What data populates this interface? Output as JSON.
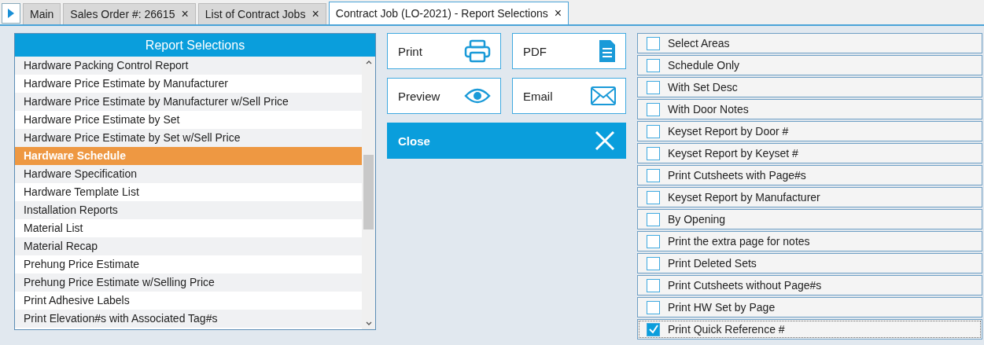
{
  "tabs": [
    {
      "label": "Main",
      "selected": false,
      "closable": false
    },
    {
      "label": "Sales Order #: 26615",
      "selected": false,
      "closable": true
    },
    {
      "label": "List of Contract Jobs",
      "selected": false,
      "closable": true
    },
    {
      "label": "Contract Job (LO-2021) - Report Selections",
      "selected": true,
      "closable": true
    }
  ],
  "close_glyph": "×",
  "report_list": {
    "title": "Report Selections",
    "items": [
      {
        "label": "Hardware Packing Control Report",
        "selected": false
      },
      {
        "label": "Hardware Price Estimate by Manufacturer",
        "selected": false
      },
      {
        "label": "Hardware Price Estimate by Manufacturer w/Sell Price",
        "selected": false
      },
      {
        "label": "Hardware Price Estimate by Set",
        "selected": false
      },
      {
        "label": "Hardware Price Estimate by Set w/Sell Price",
        "selected": false
      },
      {
        "label": "Hardware Schedule",
        "selected": true
      },
      {
        "label": "Hardware Specification",
        "selected": false
      },
      {
        "label": "Hardware Template List",
        "selected": false
      },
      {
        "label": "Installation Reports",
        "selected": false
      },
      {
        "label": "Material List",
        "selected": false
      },
      {
        "label": "Material Recap",
        "selected": false
      },
      {
        "label": "Prehung Price Estimate",
        "selected": false
      },
      {
        "label": "Prehung Price Estimate w/Selling Price",
        "selected": false
      },
      {
        "label": "Print Adhesive Labels",
        "selected": false
      },
      {
        "label": "Print Elevation#s with Associated Tag#s",
        "selected": false
      }
    ]
  },
  "actions": [
    {
      "label": "Print",
      "kind": "print"
    },
    {
      "label": "PDF",
      "kind": "pdf"
    },
    {
      "label": "Preview",
      "kind": "preview"
    },
    {
      "label": "Email",
      "kind": "email"
    },
    {
      "label": "Close",
      "kind": "close"
    }
  ],
  "options": [
    {
      "label": "Select Areas",
      "checked": false,
      "focused": false
    },
    {
      "label": "Schedule Only",
      "checked": false,
      "focused": false
    },
    {
      "label": "With Set Desc",
      "checked": false,
      "focused": false
    },
    {
      "label": "With Door Notes",
      "checked": false,
      "focused": false
    },
    {
      "label": "Keyset Report by Door #",
      "checked": false,
      "focused": false
    },
    {
      "label": "Keyset Report by Keyset #",
      "checked": false,
      "focused": false
    },
    {
      "label": "Print Cutsheets with Page#s",
      "checked": false,
      "focused": false
    },
    {
      "label": "Keyset Report by Manufacturer",
      "checked": false,
      "focused": false
    },
    {
      "label": "By Opening",
      "checked": false,
      "focused": false
    },
    {
      "label": "Print the extra page for notes",
      "checked": false,
      "focused": false
    },
    {
      "label": "Print Deleted Sets",
      "checked": false,
      "focused": false
    },
    {
      "label": "Print Cutsheets without Page#s",
      "checked": false,
      "focused": false
    },
    {
      "label": "Print HW Set by Page",
      "checked": false,
      "focused": false
    },
    {
      "label": "Print Quick Reference #",
      "checked": true,
      "focused": true
    }
  ]
}
